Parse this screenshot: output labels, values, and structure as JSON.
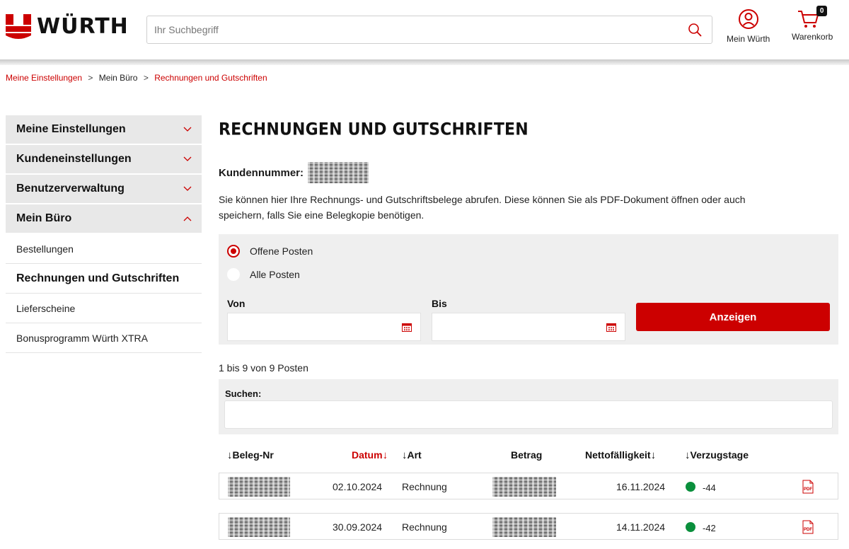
{
  "header": {
    "logo_text": "WÜRTH",
    "search_placeholder": "Ihr Suchbegriff",
    "account_label": "Mein Würth",
    "cart_label": "Warenkorb",
    "cart_count": "0"
  },
  "breadcrumb": {
    "items": [
      "Meine Einstellungen",
      "Mein Büro",
      "Rechnungen und Gutschriften"
    ],
    "separator": ">"
  },
  "sidebar": {
    "groups": [
      {
        "label": "Meine Einstellungen",
        "expanded": false
      },
      {
        "label": "Kundeneinstellungen",
        "expanded": false
      },
      {
        "label": "Benutzerverwaltung",
        "expanded": false
      },
      {
        "label": "Mein Büro",
        "expanded": true
      }
    ],
    "sub_items": [
      {
        "label": "Bestellungen",
        "active": false
      },
      {
        "label": "Rechnungen und Gutschriften",
        "active": true
      },
      {
        "label": "Lieferscheine",
        "active": false
      },
      {
        "label": "Bonusprogramm Würth XTRA",
        "active": false
      }
    ]
  },
  "main": {
    "title": "RECHNUNGEN UND GUTSCHRIFTEN",
    "customer_label": "Kundennummer:",
    "intro": "Sie können hier Ihre Rechnungs- und Gutschriftsbelege abrufen. Diese können Sie als PDF-Dokument öffnen oder auch speichern, falls Sie eine Belegkopie benötigen."
  },
  "filter": {
    "options": [
      {
        "label": "Offene Posten",
        "selected": true
      },
      {
        "label": "Alle Posten",
        "selected": false
      }
    ],
    "from_label": "Von",
    "to_label": "Bis",
    "submit_label": "Anzeigen"
  },
  "results": {
    "count_text": "1 bis 9 von 9 Posten",
    "search_label": "Suchen:"
  },
  "table": {
    "columns": [
      {
        "label": "Beleg-Nr",
        "arrow": "↓",
        "arrow_position": "before",
        "highlight": false
      },
      {
        "label": "Datum",
        "arrow": "↓",
        "arrow_position": "after",
        "highlight": true
      },
      {
        "label": "Art",
        "arrow": "↓",
        "arrow_position": "before",
        "highlight": false
      },
      {
        "label": "Betrag",
        "arrow": "",
        "arrow_position": "none",
        "highlight": false
      },
      {
        "label": "Nettofälligkeit",
        "arrow": "↓",
        "arrow_position": "after",
        "highlight": false
      },
      {
        "label": "Verzugstage",
        "arrow": "↓",
        "arrow_position": "before",
        "highlight": false
      }
    ],
    "rows": [
      {
        "date": "02.10.2024",
        "type": "Rechnung",
        "due": "16.11.2024",
        "overdue_days": "-44",
        "status_color": "#0a8f3c",
        "pdf_label": "PDF"
      },
      {
        "date": "30.09.2024",
        "type": "Rechnung",
        "due": "14.11.2024",
        "overdue_days": "-42",
        "status_color": "#0a8f3c",
        "pdf_label": "PDF"
      }
    ]
  },
  "colors": {
    "brand_red": "#cc0000",
    "status_green": "#0a8f3c"
  },
  "icons": {
    "search": "search-icon",
    "account": "user-circle-icon",
    "cart": "cart-icon",
    "calendar": "calendar-icon",
    "pdf": "pdf-file-icon",
    "expand": "chevron-down-icon",
    "collapse": "chevron-up-icon"
  }
}
